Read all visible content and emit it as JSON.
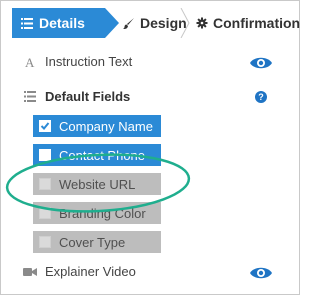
{
  "tabs": {
    "details": "Details",
    "design": "Design",
    "confirmation": "Confirmation"
  },
  "rows": {
    "instruction_text": "Instruction Text",
    "default_fields": "Default Fields",
    "explainer_video": "Explainer Video"
  },
  "help_glyph": "?",
  "fields": [
    {
      "label": "Company Name",
      "checked": true
    },
    {
      "label": "Contact Phone",
      "checked": true
    },
    {
      "label": "Website URL",
      "checked": false
    },
    {
      "label": "Branding Color",
      "checked": false
    },
    {
      "label": "Cover Type",
      "checked": false
    }
  ],
  "colors": {
    "accent": "#2b8ad6",
    "disabled": "#bdbdbd",
    "highlight_ellipse": "#1fae8e"
  },
  "icons": {
    "details": "list-icon",
    "design": "paintbrush-icon",
    "confirmation": "gear-icon",
    "instruction_text": "text-a-icon",
    "default_fields": "list-icon",
    "help": "help-icon",
    "visibility": "eye-icon",
    "explainer_video": "video-camera-icon"
  }
}
